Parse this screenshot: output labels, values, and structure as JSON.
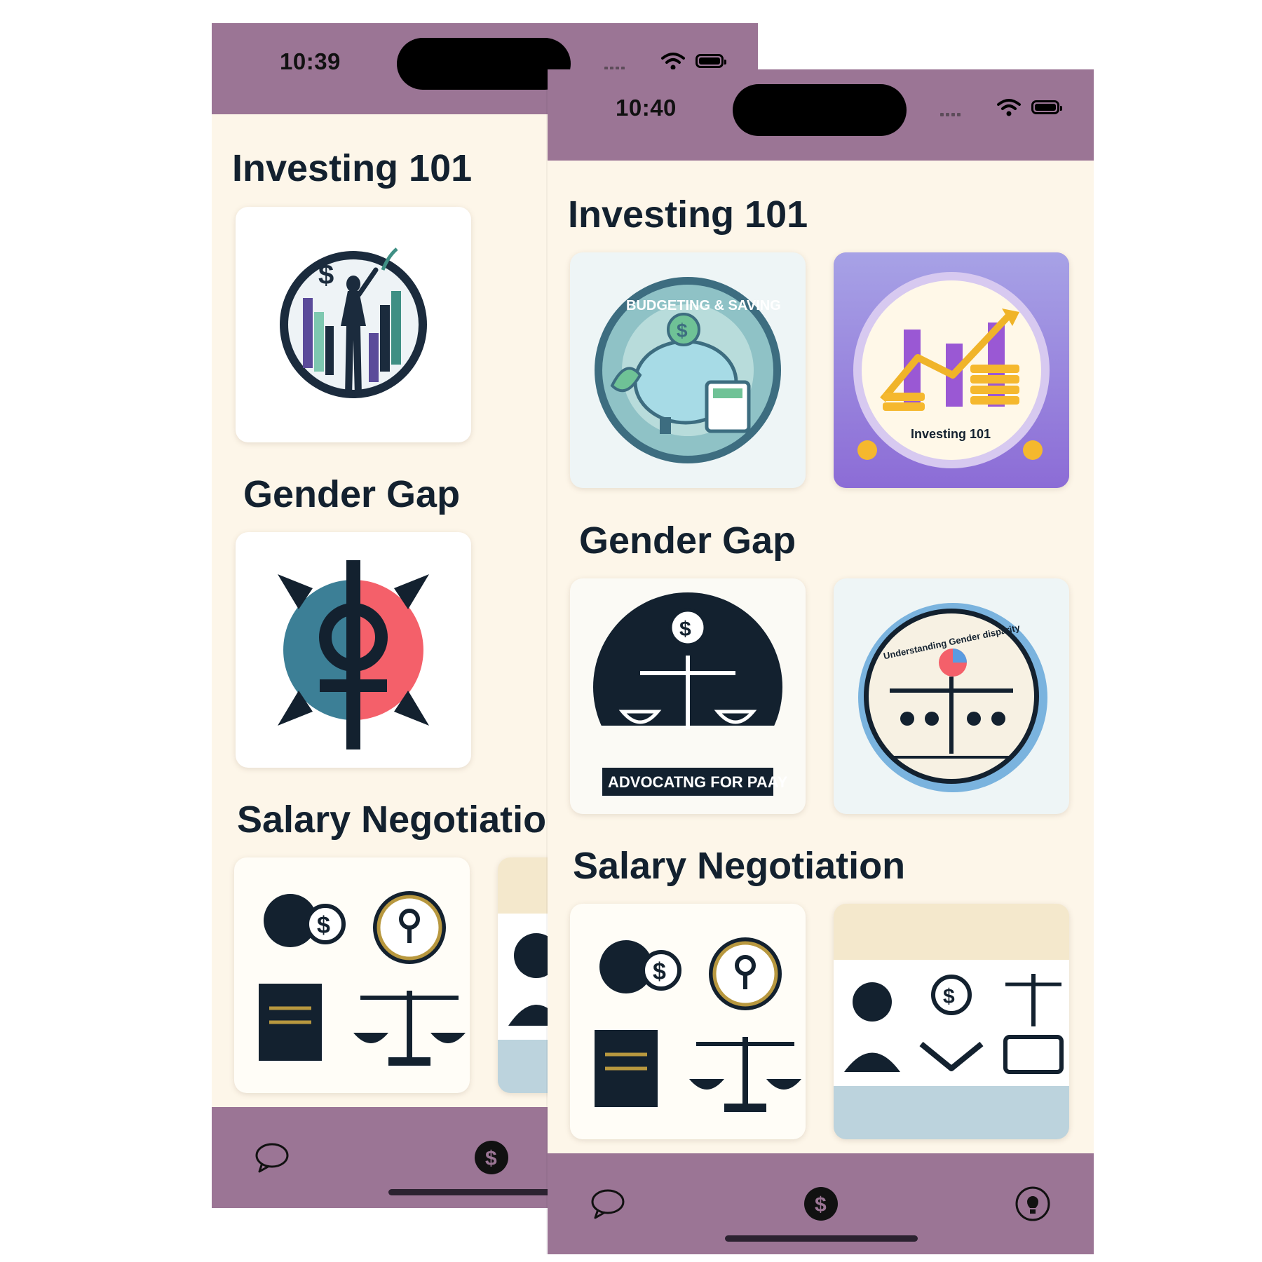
{
  "screens": [
    {
      "status_bar": {
        "time": "10:39"
      },
      "sections": [
        {
          "title": "Investing 101",
          "cards": [
            "woman-chart-logo"
          ]
        },
        {
          "title": "Gender Gap",
          "cards": [
            "gender-symbol-logo"
          ]
        },
        {
          "title": "Salary Negotiation",
          "cards": [
            "negotiation-icons",
            "negotiation-strip"
          ]
        }
      ],
      "tab_bar": {
        "tabs": [
          "chat-icon",
          "dollar-icon"
        ],
        "selected": "dollar-icon"
      }
    },
    {
      "status_bar": {
        "time": "10:40"
      },
      "sections": [
        {
          "title": "Investing 101",
          "cards": [
            {
              "icon": "budgeting-saving-badge",
              "caption": "BUDGETING & SAVING"
            },
            {
              "icon": "investing-chart-badge",
              "caption": "Investing 101"
            }
          ]
        },
        {
          "title": "Gender Gap",
          "cards": [
            {
              "icon": "advocating-pay-badge",
              "caption": "ADVOCATNG FOR PAAY"
            },
            {
              "icon": "gender-disparity-badge",
              "caption": "Understanding Gender disparity"
            }
          ]
        },
        {
          "title": "Salary Negotiation",
          "cards": [
            {
              "icon": "negotiation-icons"
            },
            {
              "icon": "negotiation-strip"
            }
          ]
        }
      ],
      "tab_bar": {
        "tabs": [
          "chat-icon",
          "dollar-icon",
          "lightbulb-icon"
        ],
        "selected": "dollar-icon"
      }
    }
  ],
  "colors": {
    "header": "#9b7595",
    "background": "#fdf6e9",
    "title": "#13212f",
    "accent_purple": "#8c6cd6",
    "accent_red": "#f4606a",
    "accent_teal": "#3c8a9a"
  }
}
